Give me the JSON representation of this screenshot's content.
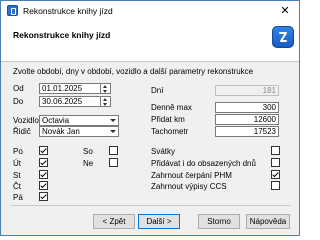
{
  "window": {
    "title": "Rekonstrukce knihy jízd",
    "close_glyph": "✕",
    "accent": "#2a6fd1"
  },
  "header": {
    "title": "Rekonstrukce knihy jízd",
    "logo_icon": "app-logo-icon"
  },
  "intro": "Zvolte období, dny v období, vozidlo a další parametry rekonstrukce",
  "period": {
    "from_label": "Od",
    "from_value": "01.01.2025",
    "to_label": "Do",
    "to_value": "30.06.2025"
  },
  "days": {
    "label": "Dní",
    "value": "181"
  },
  "vehicle": {
    "label": "Vozidlo",
    "value": "Octavia"
  },
  "driver": {
    "label": "Řidič",
    "value": "Novák Jan"
  },
  "params": {
    "max_label": "Denně max",
    "max_value": "300",
    "add_km_label": "Přidat km",
    "add_km_value": "12600",
    "odometer_label": "Tachometr",
    "odometer_value": "17523"
  },
  "weekdays": [
    {
      "label": "Po",
      "checked": true
    },
    {
      "label": "Út",
      "checked": true
    },
    {
      "label": "St",
      "checked": true
    },
    {
      "label": "Čt",
      "checked": true
    },
    {
      "label": "Pá",
      "checked": true
    },
    {
      "label": "So",
      "checked": false
    },
    {
      "label": "Ne",
      "checked": false
    }
  ],
  "options": [
    {
      "label": "Svátky",
      "checked": false
    },
    {
      "label": "Přidávat i do obsazených dnů",
      "checked": false
    },
    {
      "label": "Zahrnout čerpání PHM",
      "checked": true
    },
    {
      "label": "Zahrnout výpisy CCS",
      "checked": false
    }
  ],
  "buttons": {
    "back": "< Zpět",
    "next": "Další >",
    "cancel": "Storno",
    "help": "Nápověda"
  }
}
